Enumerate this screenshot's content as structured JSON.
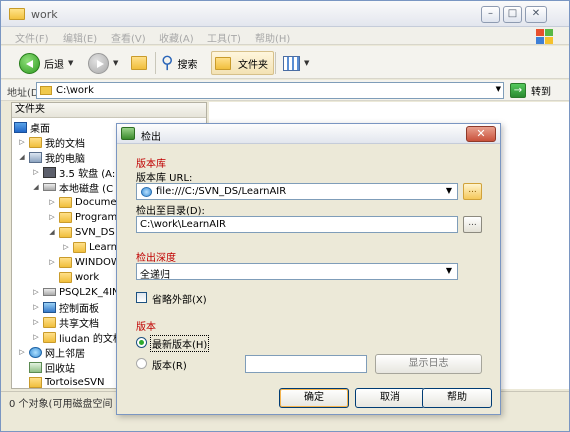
{
  "window": {
    "title": "work",
    "menu": [
      "文件(F)",
      "编辑(E)",
      "查看(V)",
      "收藏(A)",
      "工具(T)",
      "帮助(H)"
    ],
    "controls": {
      "minimize": "–",
      "maximize": "□",
      "close": "✕"
    }
  },
  "toolbar": {
    "back_label": "后退",
    "search_label": "搜索",
    "folders_label": "文件夹"
  },
  "address": {
    "label": "地址(D)",
    "value": "C:\\work",
    "go_label": "转到"
  },
  "folder_pane": {
    "header": "文件夹",
    "items": [
      {
        "label": "桌面",
        "icon": "desktop-icon"
      },
      {
        "label": "我的文档",
        "icon": "folder-icon"
      },
      {
        "label": "我的电脑",
        "icon": "computer-icon"
      },
      {
        "label": "3.5 软盘 (A:)",
        "icon": "floppy-icon"
      },
      {
        "label": "本地磁盘 (C",
        "icon": "drive-icon"
      },
      {
        "label": "Documen",
        "icon": "folder-icon"
      },
      {
        "label": "Program",
        "icon": "folder-icon"
      },
      {
        "label": "SVN_DS",
        "icon": "folder-icon"
      },
      {
        "label": "Learn",
        "icon": "folder-icon"
      },
      {
        "label": "WINDOW",
        "icon": "folder-icon"
      },
      {
        "label": "work",
        "icon": "folder-icon"
      },
      {
        "label": "PSQL2K_4INI",
        "icon": "drive-icon"
      },
      {
        "label": "控制面板",
        "icon": "control-panel-icon"
      },
      {
        "label": "共享文档",
        "icon": "folder-icon"
      },
      {
        "label": "liudan 的文档",
        "icon": "folder-icon"
      },
      {
        "label": "网上邻居",
        "icon": "network-icon"
      },
      {
        "label": "回收站",
        "icon": "recycle-bin-icon"
      },
      {
        "label": "TortoiseSVN",
        "icon": "folder-icon"
      }
    ]
  },
  "status": {
    "text": "0 个对象(可用磁盘空间"
  },
  "dialog": {
    "title": "检出",
    "close": "✕",
    "repo_section": "版本库",
    "url_label": "版本库 URL:",
    "url_value": "file:///C:/SVN_DS/LearnAIR",
    "dir_label": "检出至目录(D):",
    "dir_value": "C:\\work\\LearnAIR",
    "browse": "...",
    "depth_section": "检出深度",
    "depth_value": "全递归",
    "omit_externals": "省略外部(X)",
    "revision_section": "版本",
    "head_revision": "最新版本(H)",
    "revision": "版本(R)",
    "revision_value": "",
    "show_log": "显示日志",
    "ok": "确定",
    "cancel": "取消",
    "help": "帮助"
  }
}
